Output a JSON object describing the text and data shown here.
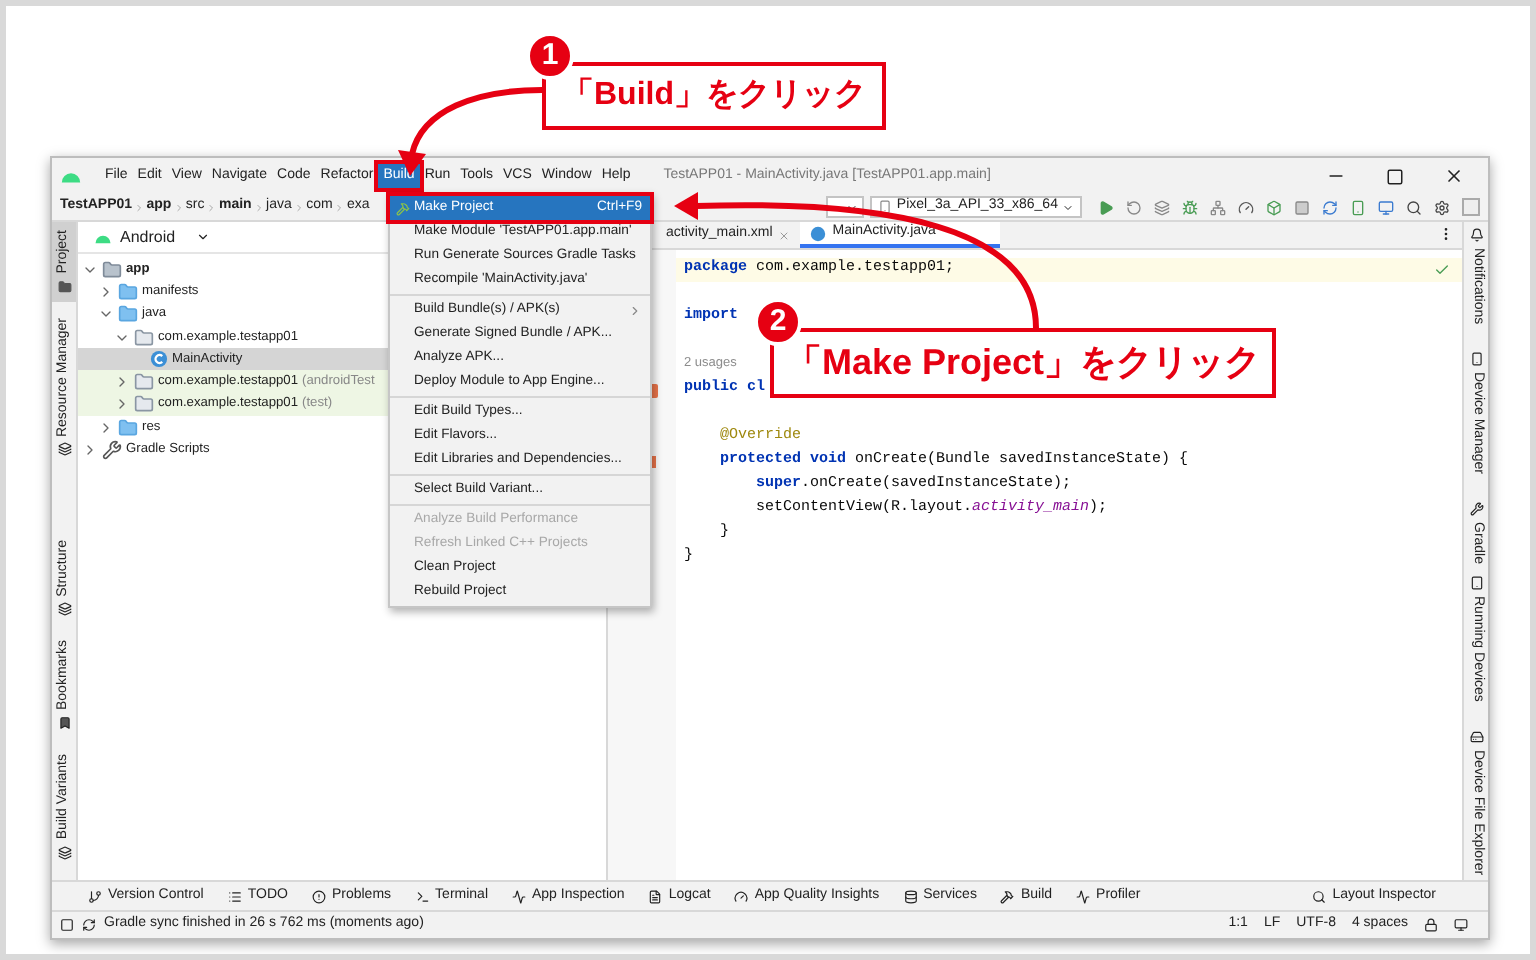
{
  "annotations": [
    {
      "number": "1",
      "text": "「Build」をクリック"
    },
    {
      "number": "2",
      "text": "「Make Project」をクリック"
    }
  ],
  "menu_bar": {
    "items": [
      {
        "label": "File",
        "selected": false
      },
      {
        "label": "Edit",
        "selected": false
      },
      {
        "label": "View",
        "selected": false
      },
      {
        "label": "Navigate",
        "selected": false
      },
      {
        "label": "Code",
        "selected": false
      },
      {
        "label": "Refactor",
        "selected": false
      },
      {
        "label": "Build",
        "selected": true
      },
      {
        "label": "Run",
        "selected": false
      },
      {
        "label": "Tools",
        "selected": false
      },
      {
        "label": "VCS",
        "selected": false
      },
      {
        "label": "Window",
        "selected": false
      },
      {
        "label": "Help",
        "selected": false
      }
    ],
    "title": "TestAPP01 - MainActivity.java [TestAPP01.app.main]"
  },
  "breadcrumbs": [
    "TestAPP01",
    "app",
    "src",
    "main",
    "java",
    "com",
    "exa"
  ],
  "toolbar": {
    "device": "Pixel_3a_API_33_x86_64"
  },
  "build_menu": {
    "groups": [
      [
        {
          "label": "Make Project",
          "shortcut": "Ctrl+F9",
          "selected": true,
          "disabled": false
        },
        {
          "label": "Make Module 'TestAPP01.app.main'",
          "selected": false,
          "disabled": false
        },
        {
          "label": "Run Generate Sources Gradle Tasks",
          "selected": false,
          "disabled": false
        },
        {
          "label": "Recompile 'MainActivity.java'",
          "selected": false,
          "disabled": false
        }
      ],
      [
        {
          "label": "Build Bundle(s) / APK(s)",
          "selected": false,
          "disabled": false,
          "submenu": true
        },
        {
          "label": "Generate Signed Bundle / APK...",
          "selected": false,
          "disabled": false
        },
        {
          "label": "Analyze APK...",
          "selected": false,
          "disabled": false
        },
        {
          "label": "Deploy Module to App Engine...",
          "selected": false,
          "disabled": false
        }
      ],
      [
        {
          "label": "Edit Build Types...",
          "selected": false,
          "disabled": false
        },
        {
          "label": "Edit Flavors...",
          "selected": false,
          "disabled": false
        },
        {
          "label": "Edit Libraries and Dependencies...",
          "selected": false,
          "disabled": false
        }
      ],
      [
        {
          "label": "Select Build Variant...",
          "selected": false,
          "disabled": false
        }
      ],
      [
        {
          "label": "Analyze Build Performance",
          "selected": false,
          "disabled": true
        },
        {
          "label": "Refresh Linked C++ Projects",
          "selected": false,
          "disabled": true
        },
        {
          "label": "Clean Project",
          "selected": false,
          "disabled": false
        },
        {
          "label": "Rebuild Project",
          "selected": false,
          "disabled": false
        }
      ]
    ]
  },
  "left_tabs": {
    "top": [
      {
        "label": "Project",
        "selected": true
      },
      {
        "label": "Resource Manager",
        "selected": false
      }
    ],
    "bottom": [
      {
        "label": "Structure",
        "selected": false
      },
      {
        "label": "Bookmarks",
        "selected": false
      },
      {
        "label": "Build Variants",
        "selected": false
      }
    ]
  },
  "project_panel": {
    "view": "Android",
    "tree": [
      {
        "label": "app",
        "kind": "module",
        "expanded": true,
        "selected": false,
        "tinted": false,
        "children": [
          {
            "label": "manifests",
            "kind": "folder",
            "expanded": false,
            "selected": false,
            "tinted": false
          },
          {
            "label": "java",
            "kind": "folder",
            "expanded": true,
            "selected": false,
            "tinted": false,
            "children": [
              {
                "label": "com.example.testapp01",
                "kind": "package",
                "expanded": true,
                "selected": false,
                "tinted": false,
                "children": [
                  {
                    "label": "MainActivity",
                    "kind": "class",
                    "selected": true,
                    "tinted": false
                  }
                ]
              },
              {
                "label": "com.example.testapp01",
                "suffix": "(androidTest",
                "kind": "package",
                "expanded": false,
                "selected": false,
                "tinted": true
              },
              {
                "label": "com.example.testapp01",
                "suffix": "(test)",
                "kind": "package",
                "expanded": false,
                "selected": false,
                "tinted": true
              }
            ]
          },
          {
            "label": "res",
            "kind": "folder",
            "expanded": false,
            "selected": false,
            "tinted": false
          }
        ]
      },
      {
        "label": "Gradle Scripts",
        "kind": "gradle",
        "expanded": false,
        "selected": false,
        "tinted": false
      }
    ]
  },
  "editor": {
    "tabs": [
      {
        "label": "activity_main.xml",
        "selected": false
      },
      {
        "label": "MainActivity.java",
        "selected": true
      }
    ],
    "lines": [
      {
        "current": true,
        "kind": "plain",
        "segments": [
          {
            "kind": "keyword",
            "text": "package"
          },
          {
            "kind": "plain",
            "text": " com.example.testapp01;"
          }
        ]
      },
      {
        "current": false,
        "kind": "plain"
      },
      {
        "current": false,
        "kind": "plain",
        "segments": [
          {
            "kind": "keyword",
            "text": "import"
          }
        ]
      },
      {
        "current": false,
        "kind": "plain"
      },
      {
        "current": false,
        "kind": "plain",
        "segments": [
          {
            "kind": "hint",
            "text": "2 usages"
          }
        ]
      },
      {
        "current": false,
        "kind": "run",
        "segments": [
          {
            "kind": "keyword",
            "text": "public cl"
          }
        ]
      },
      {
        "current": false,
        "kind": "plain"
      },
      {
        "current": false,
        "kind": "plain",
        "segments": [
          {
            "kind": "annotation",
            "text": "    @Override"
          }
        ]
      },
      {
        "current": false,
        "kind": "override",
        "segments": [
          {
            "kind": "keyword",
            "text": "    protected void"
          },
          {
            "kind": "plain",
            "text": " onCreate(Bundle savedInstanceState) {"
          }
        ]
      },
      {
        "current": false,
        "kind": "plain",
        "segments": [
          {
            "kind": "keyword",
            "text": "        super"
          },
          {
            "kind": "plain",
            "text": ".onCreate(savedInstanceState);"
          }
        ]
      },
      {
        "current": false,
        "kind": "plain",
        "segments": [
          {
            "kind": "plain",
            "text": "        setContentView(R.layout."
          },
          {
            "kind": "field",
            "text": "activity_main"
          },
          {
            "kind": "plain",
            "text": ");"
          }
        ]
      },
      {
        "current": false,
        "kind": "plain",
        "segments": [
          {
            "kind": "plain",
            "text": "    }"
          }
        ]
      },
      {
        "current": false,
        "kind": "plain",
        "segments": [
          {
            "kind": "plain",
            "text": "}"
          }
        ]
      }
    ]
  },
  "right_tabs": {
    "top": [
      "Notifications",
      "Device Manager",
      "Gradle"
    ],
    "bottom": [
      "Running Devices",
      "Device File Explorer"
    ]
  },
  "tool_windows": {
    "left": [
      "Version Control",
      "TODO",
      "Problems",
      "Terminal",
      "App Inspection",
      "Logcat",
      "App Quality Insights",
      "Services",
      "Build",
      "Profiler"
    ],
    "right": "Layout Inspector"
  },
  "status_bar": {
    "message": "Gradle sync finished in 26 s 762 ms (moments ago)",
    "items": [
      "1:1",
      "LF",
      "UTF-8",
      "4 spaces"
    ]
  }
}
